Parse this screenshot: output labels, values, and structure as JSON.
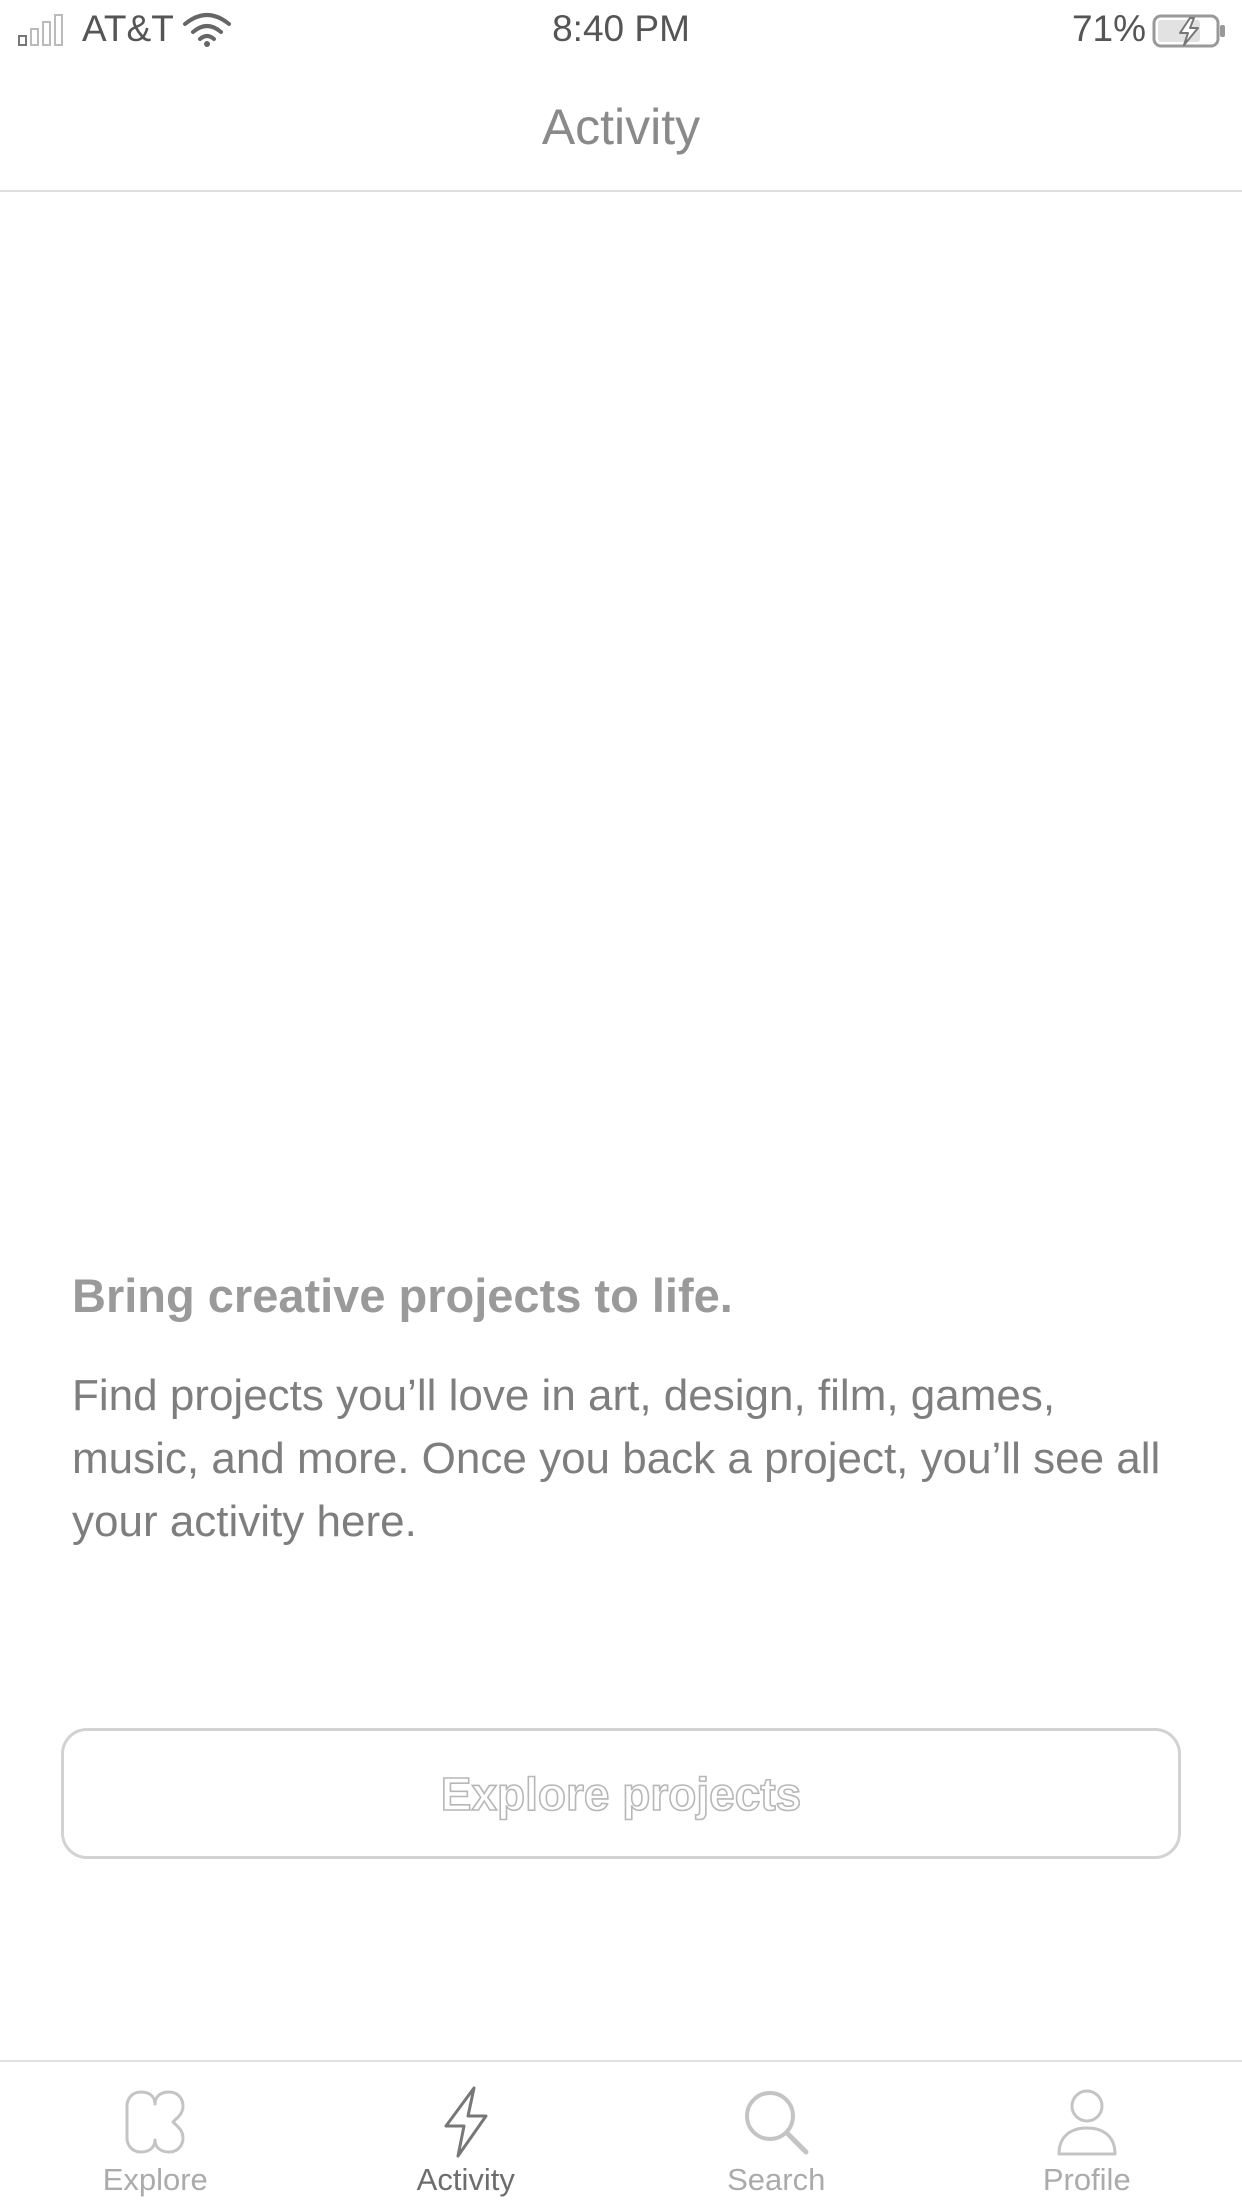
{
  "status_bar": {
    "carrier": "AT&T",
    "time": "8:40 PM",
    "battery_percent": "71%",
    "signal_icon": "cellular-signal-icon",
    "wifi_icon": "wifi-icon",
    "battery_icon": "battery-charging-icon"
  },
  "nav": {
    "title": "Activity"
  },
  "empty_state": {
    "heading": "Bring creative projects to life.",
    "body": "Find projects you’ll love in art, design, film, games, music, and more. Once you back a project, you’ll see all your activity here.",
    "button_label": "Explore projects"
  },
  "tabs": [
    {
      "label": "Explore",
      "icon": "kickstarter-logo-icon",
      "active": false
    },
    {
      "label": "Activity",
      "icon": "lightning-bolt-icon",
      "active": true
    },
    {
      "label": "Search",
      "icon": "search-icon",
      "active": false
    },
    {
      "label": "Profile",
      "icon": "person-icon",
      "active": false
    }
  ],
  "colors": {
    "background": "#ffffff",
    "text_muted": "#8a8a8a",
    "divider": "#dedede",
    "active_tab": "#6d6d6d",
    "inactive_tab": "#ababab"
  }
}
